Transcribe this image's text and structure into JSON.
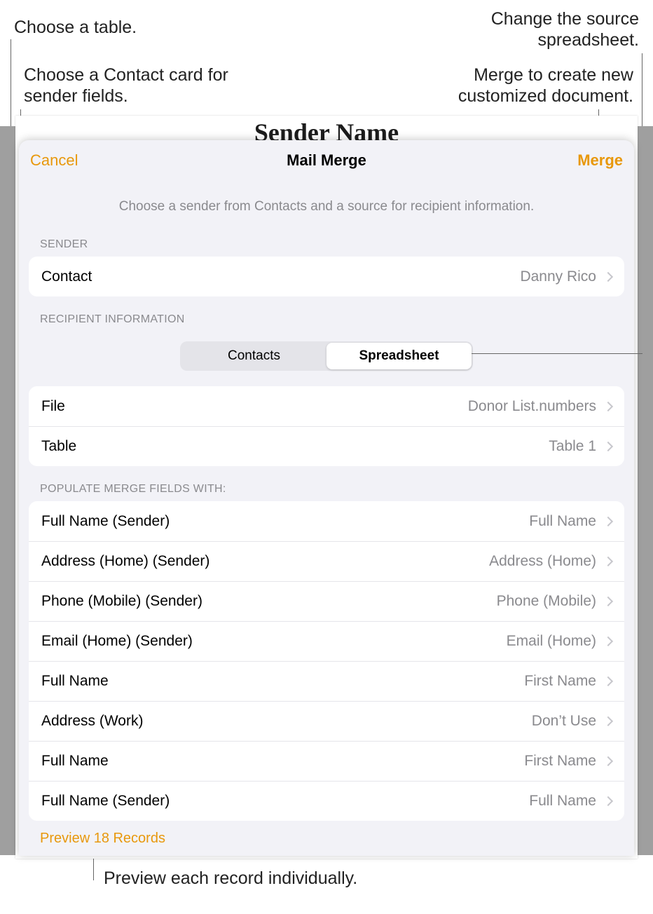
{
  "annotations": {
    "choose_table": "Choose a table.",
    "choose_contact": "Choose a Contact card for sender fields.",
    "change_source": "Change the source spreadsheet.",
    "merge_doc": "Merge to create new customized document.",
    "preview_each": "Preview each record individually."
  },
  "doc": {
    "title": "Sender Name"
  },
  "nav": {
    "cancel": "Cancel",
    "title": "Mail Merge",
    "merge": "Merge"
  },
  "subtitle": "Choose a sender from Contacts and a source for recipient information.",
  "sections": {
    "sender": "SENDER",
    "recipient": "RECIPIENT INFORMATION",
    "populate": "POPULATE MERGE FIELDS WITH:"
  },
  "sender": {
    "contact_label": "Contact",
    "contact_value": "Danny Rico"
  },
  "segments": {
    "contacts": "Contacts",
    "spreadsheet": "Spreadsheet"
  },
  "file": {
    "label": "File",
    "value": "Donor List.numbers"
  },
  "table": {
    "label": "Table",
    "value": "Table 1"
  },
  "fields": [
    {
      "label": "Full Name (Sender)",
      "value": "Full Name"
    },
    {
      "label": "Address (Home) (Sender)",
      "value": "Address (Home)"
    },
    {
      "label": "Phone (Mobile) (Sender)",
      "value": "Phone (Mobile)"
    },
    {
      "label": "Email (Home) (Sender)",
      "value": "Email (Home)"
    },
    {
      "label": "Full Name",
      "value": "First Name"
    },
    {
      "label": "Address (Work)",
      "value": "Don’t Use"
    },
    {
      "label": "Full Name",
      "value": "First Name"
    },
    {
      "label": "Full Name (Sender)",
      "value": "Full Name"
    }
  ],
  "preview": "Preview 18 Records"
}
